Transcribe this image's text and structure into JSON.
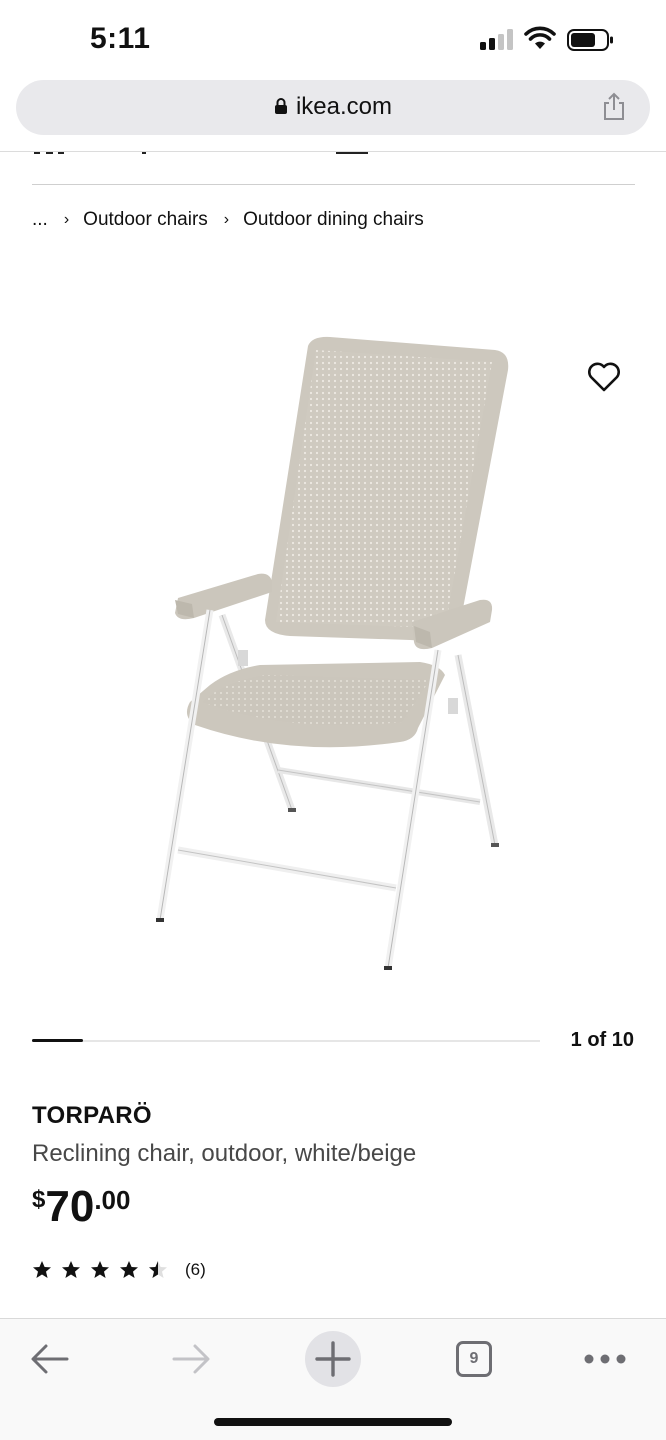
{
  "status_bar": {
    "time": "5:11",
    "icons": [
      "cellular-signal-icon",
      "wifi-icon",
      "battery-icon"
    ]
  },
  "browser": {
    "url": "ikea.com",
    "icons": [
      "lock-icon",
      "share-icon"
    ]
  },
  "breadcrumb": {
    "ellipsis": "...",
    "items": [
      "Outdoor chairs",
      "Outdoor dining chairs"
    ],
    "separator": "›"
  },
  "gallery": {
    "image_description_icon": "reclining-chair-image",
    "counter": "1 of 10",
    "current": 1,
    "total": 10
  },
  "product": {
    "name": "TORPARÖ",
    "description": "Reclining chair, outdoor, white/beige",
    "price": {
      "currency": "$",
      "whole": "70",
      "decimals": ".00"
    },
    "rating": {
      "value": 4.5,
      "max": 5,
      "review_count": "(6)"
    }
  },
  "toolbar": {
    "tab_count": "9",
    "icons": [
      "back-arrow-icon",
      "forward-arrow-icon",
      "plus-icon",
      "tabs-icon",
      "more-icon"
    ]
  },
  "colors": {
    "text": "#111111",
    "secondary_text": "#484848",
    "url_bar_bg": "#e9e9ec",
    "chair_beige": "#cfcac0",
    "frame_white": "#f1f1f1"
  }
}
